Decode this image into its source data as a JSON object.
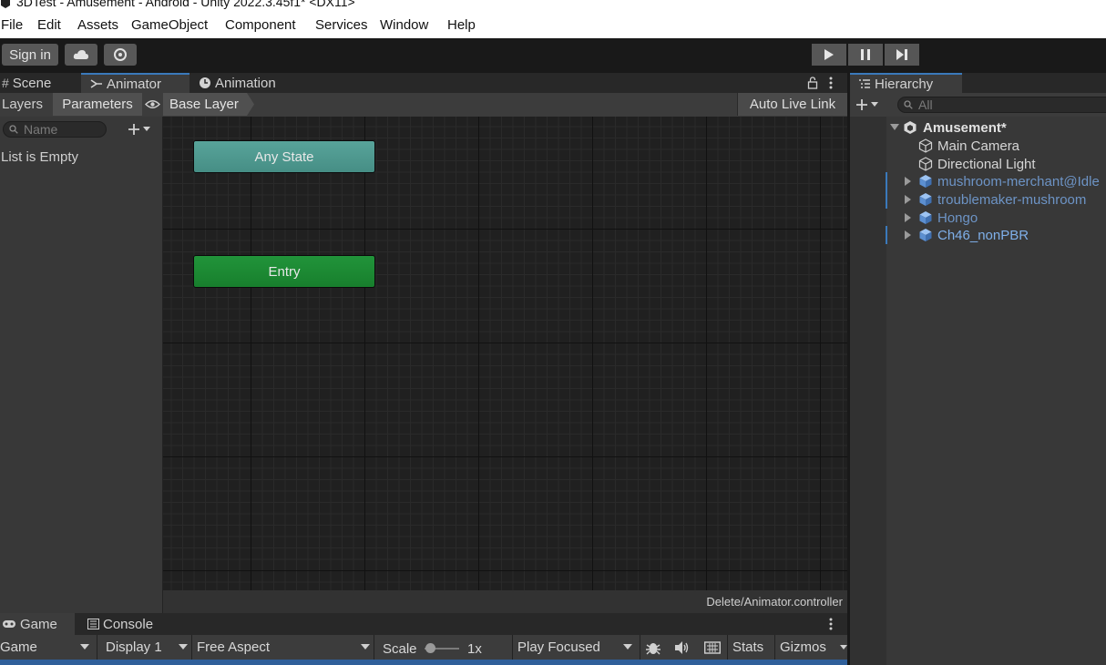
{
  "window": {
    "title": "3DTest - Amusement - Android - Unity 2022.3.45f1* <DX11>"
  },
  "menu": [
    "File",
    "Edit",
    "Assets",
    "GameObject",
    "Component",
    "Services",
    "Window",
    "Help"
  ],
  "toolbar": {
    "sign_in": "Sign in",
    "cloud_icon": "cloud-icon",
    "settings_icon": "gear-icon"
  },
  "animator": {
    "tabs": [
      "Scene",
      "Animator",
      "Animation"
    ],
    "left_tabs": [
      "Layers",
      "Parameters"
    ],
    "search_placeholder": "Name",
    "list_empty": "List is Empty",
    "breadcrumb": "Base Layer",
    "auto_live_link": "Auto Live Link",
    "nodes": {
      "any_state": "Any State",
      "entry": "Entry"
    },
    "footer_path": "Delete/Animator.controller",
    "colors": {
      "any_state": "#4d9a90",
      "entry": "#1a8a2e"
    }
  },
  "game": {
    "tabs": [
      "Game",
      "Console"
    ],
    "mode": "Game",
    "display": "Display 1",
    "aspect": "Free Aspect",
    "scale_label": "Scale",
    "scale_value": "1x",
    "play_mode": "Play Focused",
    "stats": "Stats",
    "gizmos": "Gizmos"
  },
  "hierarchy": {
    "tab": "Hierarchy",
    "search_placeholder": "All",
    "scene": "Amusement*",
    "items": [
      {
        "name": "Main Camera",
        "type": "object"
      },
      {
        "name": "Directional Light",
        "type": "object"
      },
      {
        "name": "mushroom-merchant@Idle",
        "type": "prefab"
      },
      {
        "name": "troublemaker-mushroom",
        "type": "prefab"
      },
      {
        "name": "Hongo",
        "type": "prefab"
      },
      {
        "name": "Ch46_nonPBR",
        "type": "prefab"
      }
    ]
  }
}
